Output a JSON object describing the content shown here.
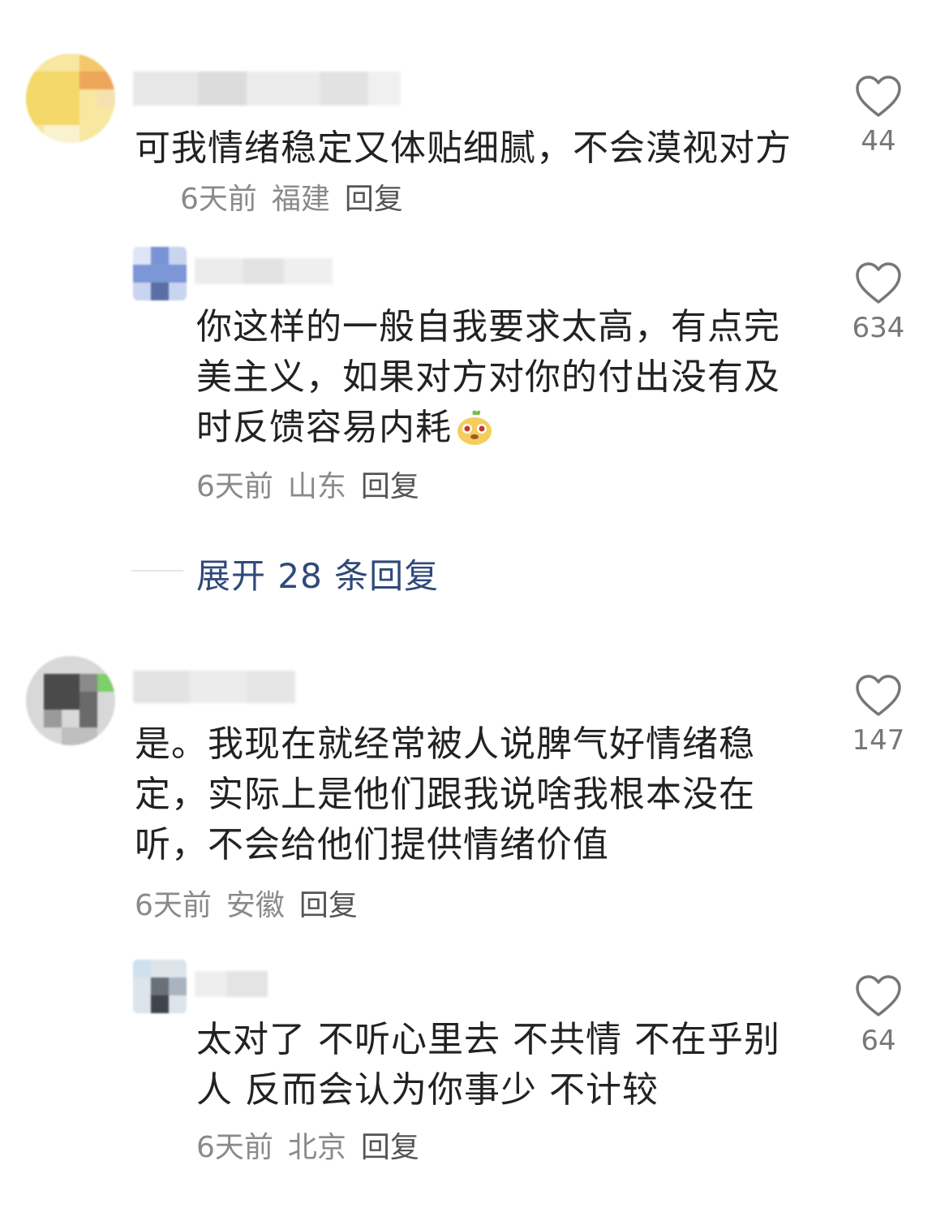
{
  "comments": [
    {
      "text": "可我情绪稳定又体贴细腻，不会漠视对方",
      "time": "6天前",
      "location": "福建",
      "reply_label": "回复",
      "likes": "44",
      "replies": [
        {
          "text": "你这样的一般自我要求太高，有点完美主义，如果对方对你的付出没有及时反馈容易内耗",
          "emoji": "cute-face-emoji",
          "time": "6天前",
          "location": "山东",
          "reply_label": "回复",
          "likes": "634"
        }
      ],
      "expand_label": "展开 28 条回复"
    },
    {
      "text": "是。我现在就经常被人说脾气好情绪稳定，实际上是他们跟我说啥我根本没在听，不会给他们提供情绪价值",
      "time": "6天前",
      "location": "安徽",
      "reply_label": "回复",
      "likes": "147",
      "replies": [
        {
          "text": "太对了 不听心里去 不共情 不在乎别人 反而会认为你事少 不计较",
          "time": "6天前",
          "location": "北京",
          "reply_label": "回复",
          "likes": "64"
        }
      ]
    }
  ],
  "icons": {
    "like": "heart-outline-icon"
  },
  "colors": {
    "text": "#222222",
    "meta": "#8a8a8a",
    "expand": "#2f4a7a",
    "icon": "#777777"
  }
}
